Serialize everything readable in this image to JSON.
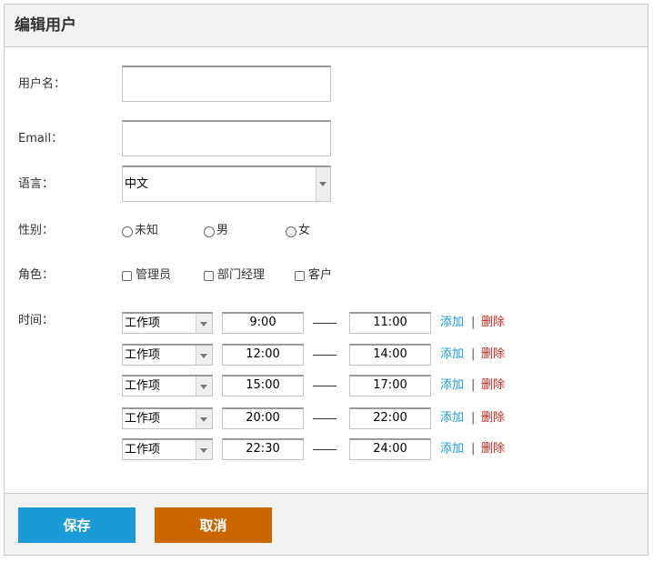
{
  "header": {
    "title": "编辑用户"
  },
  "fields": {
    "username": {
      "label": "用户名：",
      "value": ""
    },
    "email": {
      "label": "Email：",
      "value": ""
    },
    "language": {
      "label": "语言：",
      "selected": "中文"
    },
    "gender": {
      "label": "性别：",
      "options": [
        "未知",
        "男",
        "女"
      ]
    },
    "role": {
      "label": "角色：",
      "options": [
        "管理员",
        "部门经理",
        "客户"
      ]
    },
    "time": {
      "label": "时间：",
      "rows": [
        {
          "type": "工作项",
          "start": "9:00",
          "end": "11:00"
        },
        {
          "type": "工作项",
          "start": "12:00",
          "end": "14:00"
        },
        {
          "type": "工作项",
          "start": "15:00",
          "end": "17:00"
        },
        {
          "type": "工作项",
          "start": "20:00",
          "end": "22:00"
        },
        {
          "type": "工作项",
          "start": "22:30",
          "end": "24:00"
        }
      ],
      "add_label": "添加",
      "separator": "|",
      "delete_label": "删除"
    }
  },
  "footer": {
    "save_label": "保存",
    "cancel_label": "取消"
  },
  "colors": {
    "primary": "#1a9ad6",
    "cancel": "#cc6600",
    "danger": "#d9251d"
  }
}
